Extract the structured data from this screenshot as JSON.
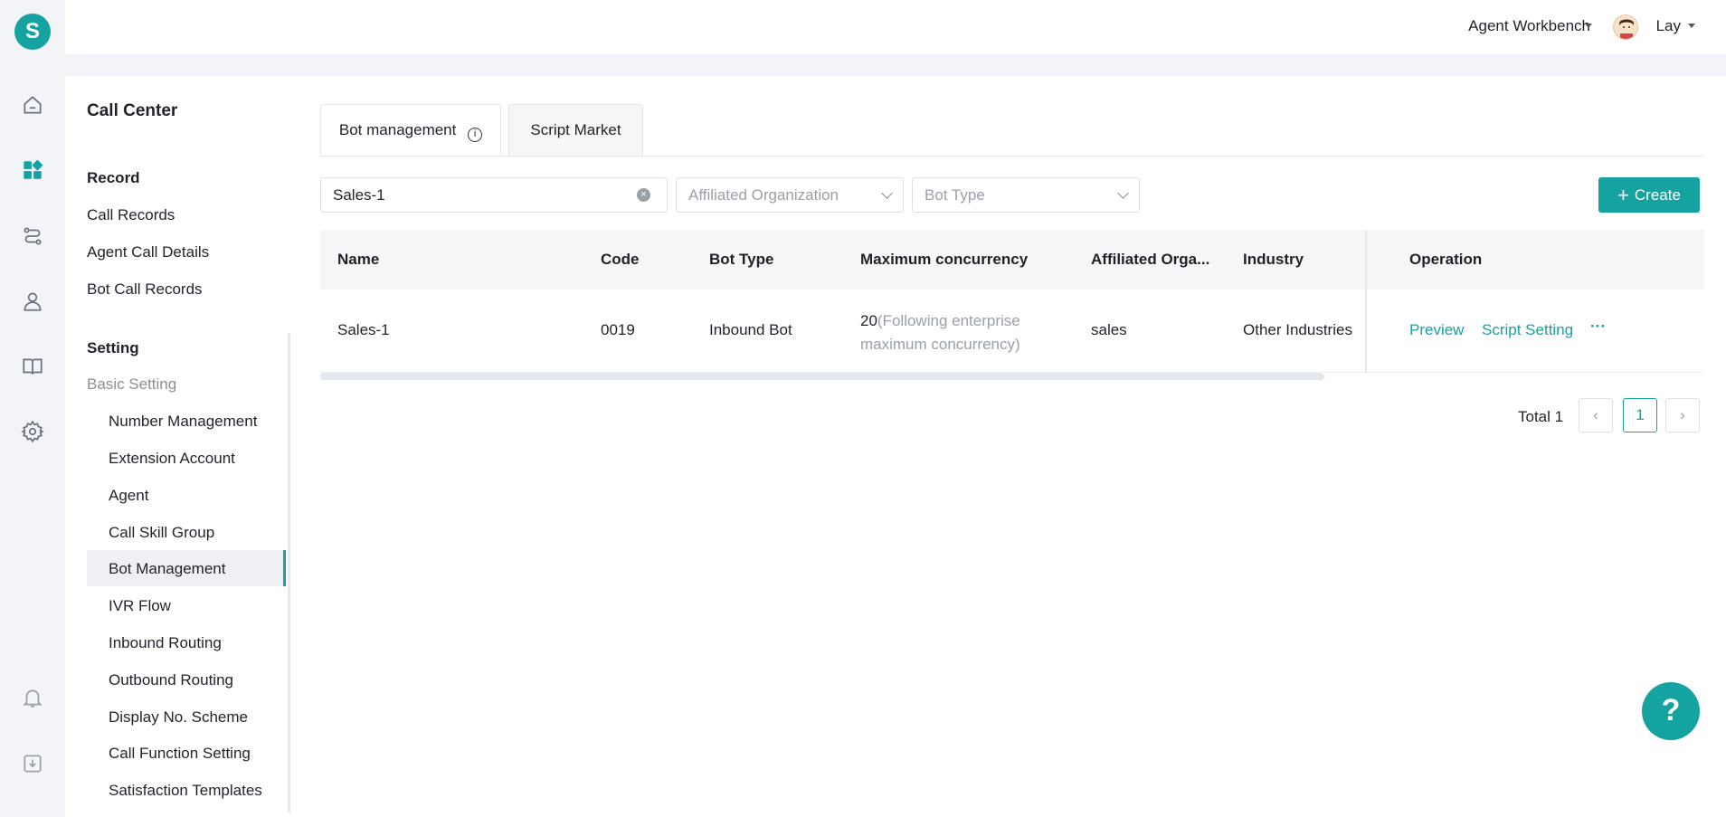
{
  "topbar": {
    "workbench_label": "Agent Workbench",
    "user_name": "Lay"
  },
  "brand": {
    "logo_letter": "S",
    "accent_color": "#14a3a0"
  },
  "rail_icons": [
    "home-icon",
    "apps-icon",
    "routing-icon",
    "user-icon",
    "book-icon",
    "settings-icon",
    "bell-icon",
    "download-icon"
  ],
  "sidebar": {
    "title": "Call Center",
    "record_group": "Record",
    "record_items": [
      "Call Records",
      "Agent Call Details",
      "Bot Call Records"
    ],
    "setting_group": "Setting",
    "basic_setting": "Basic Setting",
    "setting_items": [
      "Number Management",
      "Extension Account",
      "Agent",
      "Call Skill Group",
      "Bot Management",
      "IVR Flow",
      "Inbound Routing",
      "Outbound Routing",
      "Display No. Scheme",
      "Call Function Setting",
      "Satisfaction Templates"
    ],
    "active_item": "Bot Management"
  },
  "tabs": [
    {
      "label": "Bot management",
      "active": true
    },
    {
      "label": "Script Market",
      "active": false
    }
  ],
  "filters": {
    "search_value": "Sales-1",
    "organization_placeholder": "Affiliated Organization",
    "bot_type_placeholder": "Bot Type",
    "create_label": "Create"
  },
  "table": {
    "columns": [
      "Name",
      "Code",
      "Bot Type",
      "Maximum concurrency",
      "Affiliated Orga...",
      "Industry",
      "Operation"
    ],
    "rows": [
      {
        "name": "Sales-1",
        "code": "0019",
        "bot_type": "Inbound Bot",
        "concurrency": "20",
        "concurrency_note_1": "(Following enterprise",
        "concurrency_note_2": "maximum concurrency)",
        "organization": "sales",
        "industry": "Other Industries",
        "op_preview": "Preview",
        "op_script": "Script Setting",
        "op_more": "···"
      }
    ]
  },
  "pagination": {
    "total_label": "Total 1",
    "current_page": "1"
  },
  "help_button": "?"
}
